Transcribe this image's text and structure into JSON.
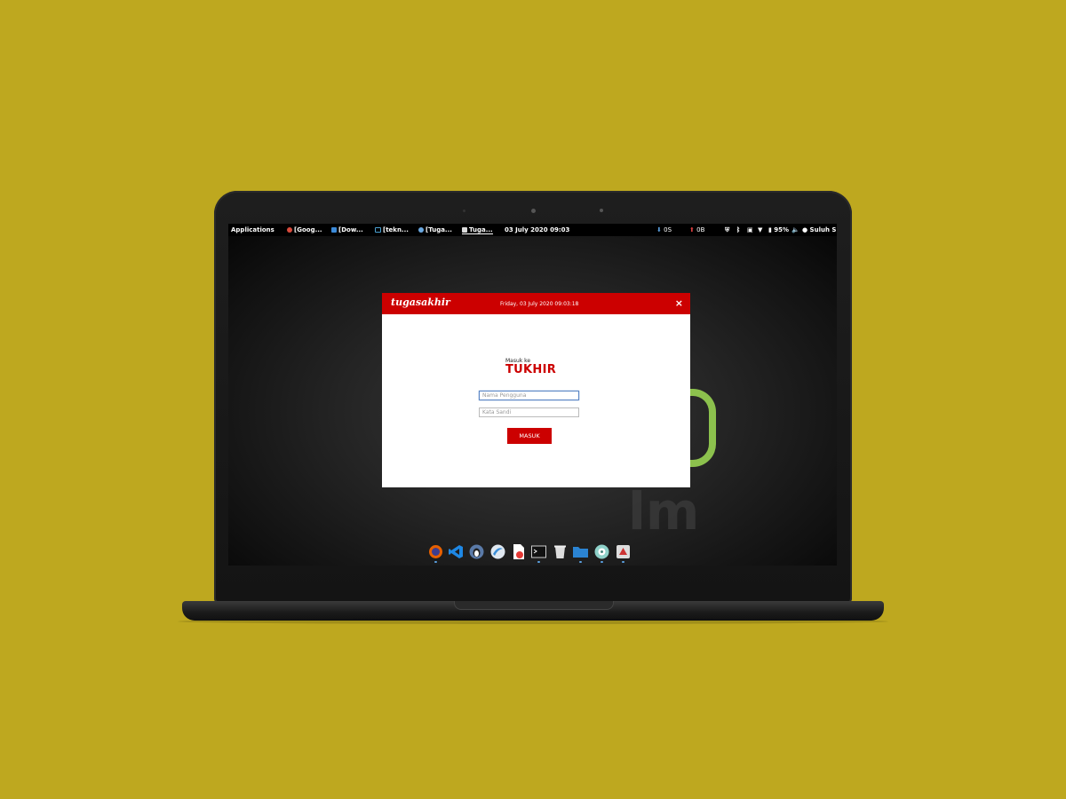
{
  "topbar": {
    "applications": "Applications",
    "tasks": [
      {
        "label": "[Goog...",
        "icon": "chrome-icon",
        "color": "#d84a3c"
      },
      {
        "label": "[Dow...",
        "icon": "folder-icon",
        "color": "#3c8ad8"
      },
      {
        "label": "[tekn...",
        "icon": "terminal-icon",
        "color": "#4aa0d0"
      },
      {
        "label": "[Tuga...",
        "icon": "globe-icon",
        "color": "#6aa8e0"
      },
      {
        "label": "Tuga...",
        "icon": "app-icon",
        "color": "#dddddd"
      }
    ],
    "clock": "03 July 2020 09:03",
    "indicator1": "0S",
    "indicator2": "0B",
    "battery": "95%",
    "user": "Suluh S"
  },
  "dialog": {
    "logo": "tugasakhir",
    "datetime": "Friday, 03 July 2020  09:03:18",
    "close": "×",
    "welcome": "Masuk ke",
    "brand": "TUKHIR",
    "username_placeholder": "Nama Pengguna",
    "password_placeholder": "Kata Sandi",
    "login_button": "MASUK"
  },
  "dock": {
    "items": [
      {
        "name": "firefox-icon",
        "color": "#e66000"
      },
      {
        "name": "vscode-icon",
        "color": "#1e88e5"
      },
      {
        "name": "tux-icon",
        "color": "#5a7aa8"
      },
      {
        "name": "browser-icon",
        "color": "#3b8ed8"
      },
      {
        "name": "pdf-icon",
        "color": "#e53935"
      },
      {
        "name": "terminal-icon",
        "color": "#222222"
      },
      {
        "name": "trash-icon",
        "color": "#cccccc"
      },
      {
        "name": "folder-icon",
        "color": "#2b84d3"
      },
      {
        "name": "disk-icon",
        "color": "#8ed1c9"
      },
      {
        "name": "system-icon",
        "color": "#dddddd"
      }
    ]
  },
  "colors": {
    "background": "#bea81f",
    "accent": "#cc0000",
    "mint": "#8cc14d"
  }
}
